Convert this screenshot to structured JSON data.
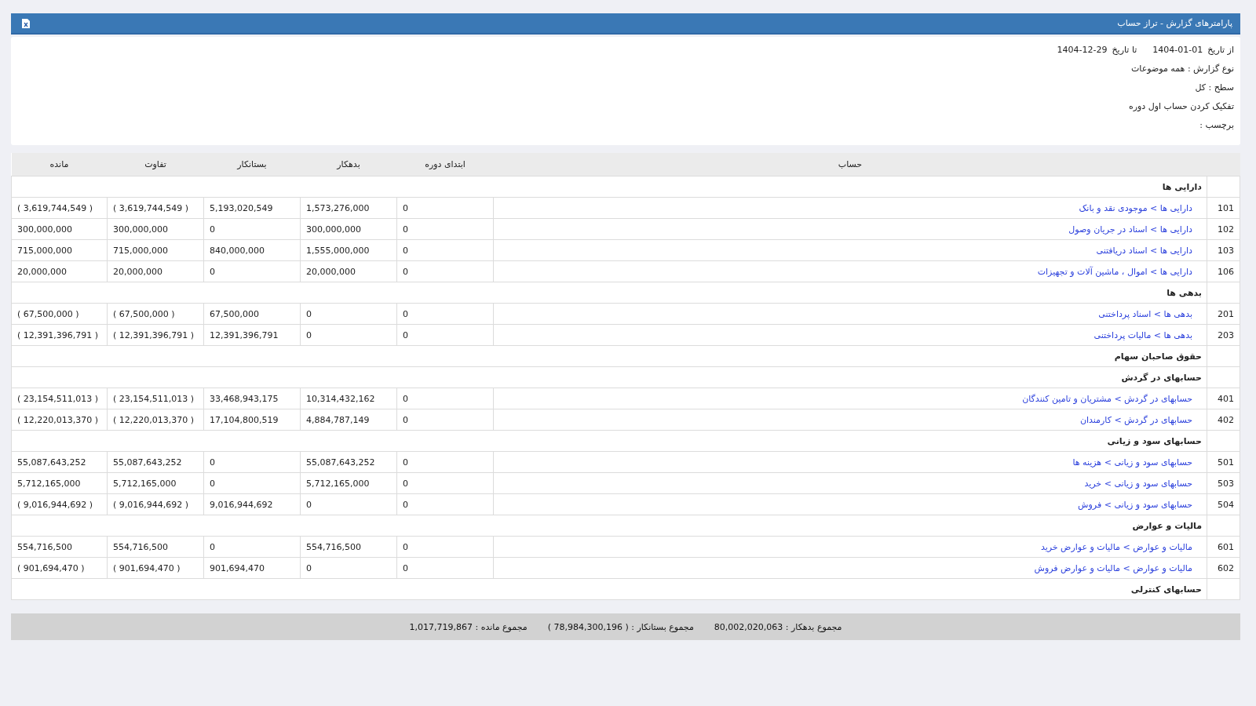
{
  "header": {
    "title": "پارامترهای گزارش - تراز حساب"
  },
  "params": {
    "from_label": "از تاریخ",
    "from_value": "1404-01-01",
    "to_label": "تا تاریخ",
    "to_value": "1404-12-29",
    "lines": [
      "نوع گزارش : همه موضوعات",
      "سطح : کل",
      "تفکیک کردن حساب اول دوره",
      "برچسب :"
    ]
  },
  "table": {
    "columns": [
      "",
      "حساب",
      "ابتدای دوره",
      "بدهکار",
      "بستانکار",
      "تفاوت",
      "مانده"
    ],
    "rows": [
      {
        "kind": "group",
        "title": "دارایی ها"
      },
      {
        "kind": "account",
        "code": "101",
        "name": "دارایی ها > موجودی نقد و بانک",
        "values": [
          "0",
          "1,573,276,000",
          "5,193,020,549",
          "( 3,619,744,549 )",
          "( 3,619,744,549 )"
        ]
      },
      {
        "kind": "account",
        "code": "102",
        "name": "دارایی ها > اسناد در جریان وصول",
        "values": [
          "0",
          "300,000,000",
          "0",
          "300,000,000",
          "300,000,000"
        ]
      },
      {
        "kind": "account",
        "code": "103",
        "name": "دارایی ها > اسناد دریافتنی",
        "values": [
          "0",
          "1,555,000,000",
          "840,000,000",
          "715,000,000",
          "715,000,000"
        ]
      },
      {
        "kind": "account",
        "code": "106",
        "name": "دارایی ها > اموال ، ماشین آلات و تجهیزات",
        "values": [
          "0",
          "20,000,000",
          "0",
          "20,000,000",
          "20,000,000"
        ]
      },
      {
        "kind": "group",
        "title": "بدهی ها"
      },
      {
        "kind": "account",
        "code": "201",
        "name": "بدهی ها > اسناد پرداختنی",
        "values": [
          "0",
          "0",
          "67,500,000",
          "( 67,500,000 )",
          "( 67,500,000 )"
        ]
      },
      {
        "kind": "account",
        "code": "203",
        "name": "بدهی ها > مالیات پرداختنی",
        "values": [
          "0",
          "0",
          "12,391,396,791",
          "( 12,391,396,791 )",
          "( 12,391,396,791 )"
        ]
      },
      {
        "kind": "group",
        "title": "حقوق صاحبان سهام"
      },
      {
        "kind": "group",
        "title": "حسابهای در گردش"
      },
      {
        "kind": "account",
        "code": "401",
        "name": "حسابهای در گردش > مشتریان و تامین کنندگان",
        "values": [
          "0",
          "10,314,432,162",
          "33,468,943,175",
          "( 23,154,511,013 )",
          "( 23,154,511,013 )"
        ]
      },
      {
        "kind": "account",
        "code": "402",
        "name": "حسابهای در گردش > کارمندان",
        "values": [
          "0",
          "4,884,787,149",
          "17,104,800,519",
          "( 12,220,013,370 )",
          "( 12,220,013,370 )"
        ]
      },
      {
        "kind": "group",
        "title": "حسابهای سود و زیانی"
      },
      {
        "kind": "account",
        "code": "501",
        "name": "حسابهای سود و زیانی > هزینه ها",
        "values": [
          "0",
          "55,087,643,252",
          "0",
          "55,087,643,252",
          "55,087,643,252"
        ]
      },
      {
        "kind": "account",
        "code": "503",
        "name": "حسابهای سود و زیانی > خرید",
        "values": [
          "0",
          "5,712,165,000",
          "0",
          "5,712,165,000",
          "5,712,165,000"
        ]
      },
      {
        "kind": "account",
        "code": "504",
        "name": "حسابهای سود و زیانی > فروش",
        "values": [
          "0",
          "0",
          "9,016,944,692",
          "( 9,016,944,692 )",
          "( 9,016,944,692 )"
        ]
      },
      {
        "kind": "group",
        "title": "مالیات و عوارض"
      },
      {
        "kind": "account",
        "code": "601",
        "name": "مالیات و عوارض > مالیات و عوارض خرید",
        "values": [
          "0",
          "554,716,500",
          "0",
          "554,716,500",
          "554,716,500"
        ]
      },
      {
        "kind": "account",
        "code": "602",
        "name": "مالیات و عوارض > مالیات و عوارض فروش",
        "values": [
          "0",
          "0",
          "901,694,470",
          "( 901,694,470 )",
          "( 901,694,470 )"
        ]
      },
      {
        "kind": "group",
        "title": "حسابهای کنترلی"
      }
    ]
  },
  "totals": [
    "مجموع بدهکار : 80,002,020,063",
    "مجموع بستانکار : ( 78,984,300,196 )",
    "مجموع مانده : 1,017,719,867"
  ]
}
